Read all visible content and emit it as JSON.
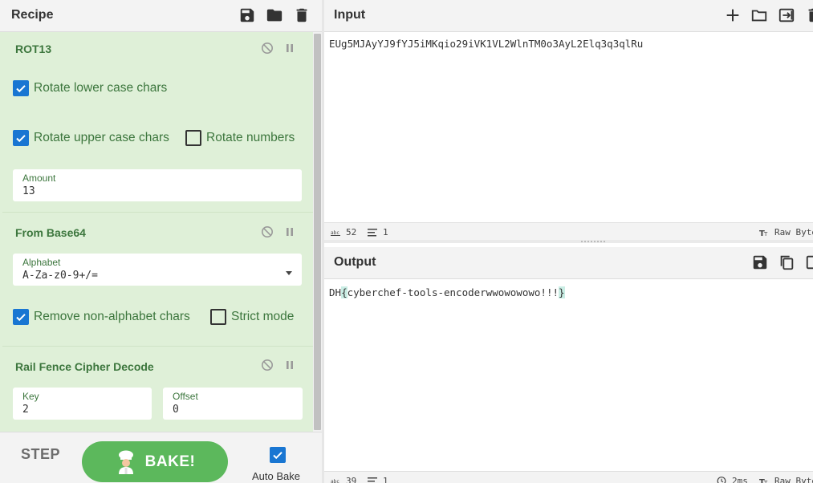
{
  "recipe": {
    "title": "Recipe",
    "header_icons": [
      "save-icon",
      "folder-icon",
      "trash-icon"
    ],
    "operations": [
      {
        "title": "ROT13",
        "checkboxes": [
          {
            "label": "Rotate lower case chars",
            "checked": true
          },
          {
            "label": "Rotate upper case chars",
            "checked": true
          },
          {
            "label": "Rotate numbers",
            "checked": false
          }
        ],
        "fields": [
          {
            "label": "Amount",
            "value": "13"
          }
        ]
      },
      {
        "title": "From Base64",
        "fields": [
          {
            "label": "Alphabet",
            "value": "A-Za-z0-9+/="
          }
        ],
        "checkboxes": [
          {
            "label": "Remove non-alphabet chars",
            "checked": true
          },
          {
            "label": "Strict mode",
            "checked": false
          }
        ]
      },
      {
        "title": "Rail Fence Cipher Decode",
        "fields": [
          {
            "label": "Key",
            "value": "2"
          },
          {
            "label": "Offset",
            "value": "0"
          }
        ]
      }
    ]
  },
  "bake_bar": {
    "step_label": "STEP",
    "bake_label": "BAKE!",
    "auto_bake_label": "Auto Bake",
    "auto_bake_checked": true
  },
  "input": {
    "title": "Input",
    "header_icons": [
      "plus-icon",
      "folder-icon",
      "sign-in-icon",
      "trash-icon"
    ],
    "text": "EUg5MJAyYJ9fYJ5iMKqio29iVK1VL2WlnTM0o3AyL2Elq3q3qlRu",
    "status": {
      "length": "52",
      "lines": "1",
      "encoding": "Raw Bytes"
    }
  },
  "output": {
    "title": "Output",
    "header_icons": [
      "save-icon",
      "copy-icon",
      "replace-input-icon"
    ],
    "text_prefix": "DH",
    "text_open_brace": "{",
    "text_body": "cyberchef-tools-encoderwwowowowo!!!",
    "text_close_brace": "}",
    "status": {
      "length": "39",
      "lines": "1",
      "time": "2ms",
      "encoding": "Raw Bytes"
    }
  },
  "colors": {
    "op_background": "#dff0d8",
    "op_text": "#3c763d",
    "checkbox_blue": "#1976d2",
    "bake_green": "#5cb85c"
  }
}
